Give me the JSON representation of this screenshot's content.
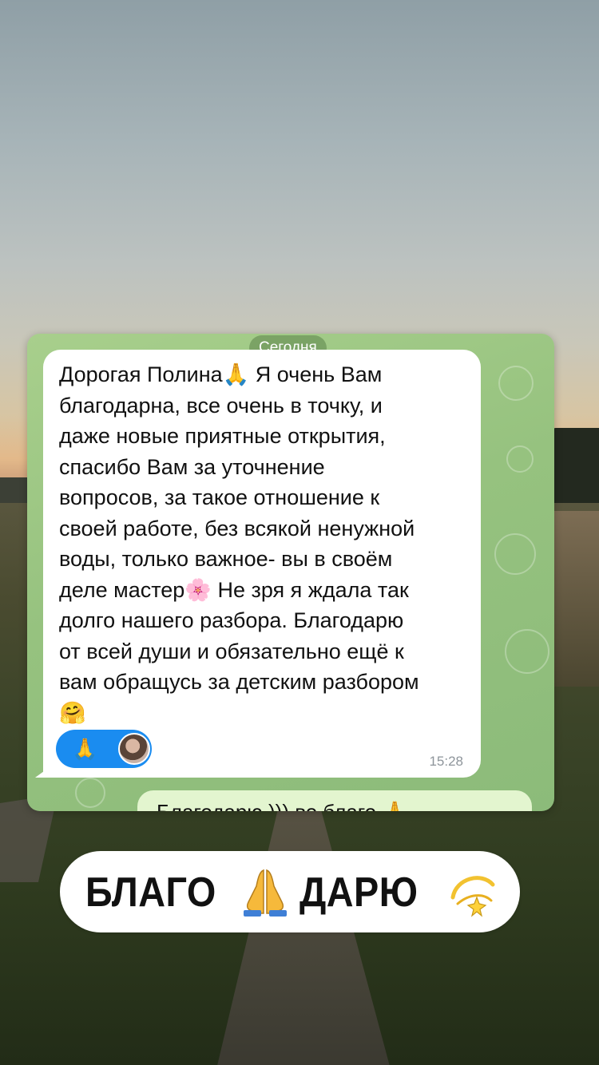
{
  "chat": {
    "date_label": "Сегодня",
    "message": {
      "text": "Дорогая Полина🙏 Я очень Вам\nблагодарна, все очень в точку, и\nдаже новые приятные открытия,\nспасибо Вам за уточнение\nвопросов, за такое отношение к\nсвоей работе, без всякой ненужной\nводы, только важное- вы в своём\nделе мастер🌸 Не зря я ждала так\nдолго нашего разбора. Благодарю\nот всей души и обязательно ещё к\nвам обращусь за детским разбором\n🤗",
      "time": "15:28",
      "reaction_emoji": "🙏"
    },
    "reply": {
      "text": "Благодарю ))) во благо 🙏"
    }
  },
  "sticker": {
    "word1": "БЛАГО",
    "word2": "ДАРЮ",
    "icon1": "praying-hands-icon",
    "icon2": "dizzy-star-icon"
  },
  "colors": {
    "chat_background": "#9cc784",
    "incoming_bubble": "#ffffff",
    "outgoing_bubble": "#e3f5cf",
    "reaction_pill": "#1a8cf0"
  }
}
